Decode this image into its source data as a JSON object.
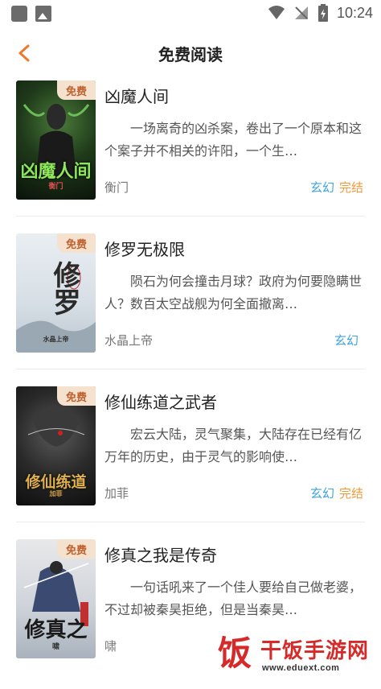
{
  "status_bar": {
    "time": "10:24"
  },
  "header": {
    "title": "免费阅读"
  },
  "books": [
    {
      "title": "凶魔人间",
      "description": "一场离奇的凶杀案，卷出了一个原本和这个案子并不相关的许阳，一个生…",
      "author": "衡门",
      "genre": "玄幻",
      "status": "完结",
      "badge": "免费",
      "cover_text": "凶魔人间",
      "cover_subtext": "衡门"
    },
    {
      "title": "修罗无极限",
      "description": "陨石为何会撞击月球？政府为何要隐瞒世人？数百太空战舰为何全面撤离…",
      "author": "水晶上帝",
      "genre": "玄幻",
      "status": "",
      "badge": "免费",
      "cover_text": "修罗",
      "cover_subtext": "水晶上帝"
    },
    {
      "title": "修仙练道之武者",
      "description": "宏云大陆，灵气聚集，大陆存在已经有亿万年的历史，由于灵气的影响使…",
      "author": "加菲",
      "genre": "玄幻",
      "status": "完结",
      "badge": "免费",
      "cover_text": "修仙练道",
      "cover_subtext": "加菲"
    },
    {
      "title": "修真之我是传奇",
      "description": "一句话吼来了一个佳人要给自己做老婆，不过却被秦昊拒绝，但是当秦昊…",
      "author": "啸",
      "genre": "",
      "status": "",
      "badge": "免费",
      "cover_text": "修真之",
      "cover_subtext": "啸"
    }
  ],
  "watermark": {
    "brand": "干饭手游网",
    "url": "www.eduext.com",
    "glyph": "饭"
  },
  "colors": {
    "accent": "#f0782d",
    "genre": "#3ea3e1",
    "status": "#f29a3b",
    "badge_bg": "#f4e2cf"
  }
}
